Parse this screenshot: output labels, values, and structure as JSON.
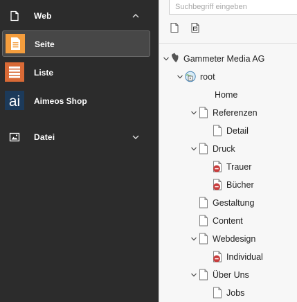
{
  "menu": {
    "web_label": "Web",
    "seite_label": "Seite",
    "liste_label": "Liste",
    "aimeos_label": "Aimeos Shop",
    "datei_label": "Datei"
  },
  "tree": {
    "search_placeholder": "Suchbegriff eingeben",
    "site_label": "Gammeter Media AG",
    "root_label": "root",
    "home_label": "Home",
    "referenzen_label": "Referenzen",
    "detail_label": "Detail",
    "druck_label": "Druck",
    "trauer_label": "Trauer",
    "buecher_label": "Bücher",
    "gestaltung_label": "Gestaltung",
    "content_label": "Content",
    "webdesign_label": "Webdesign",
    "individual_label": "Individual",
    "ueberuns_label": "Über Uns",
    "jobs_label": "Jobs"
  },
  "colors": {
    "sidebar_bg": "#2c2c2c",
    "seite_icon_bg": "#f49d3d",
    "liste_icon_bg": "#d96a36",
    "aimeos_icon_bg": "#1c3a5a",
    "restricted_badge": "#c83c3c"
  }
}
